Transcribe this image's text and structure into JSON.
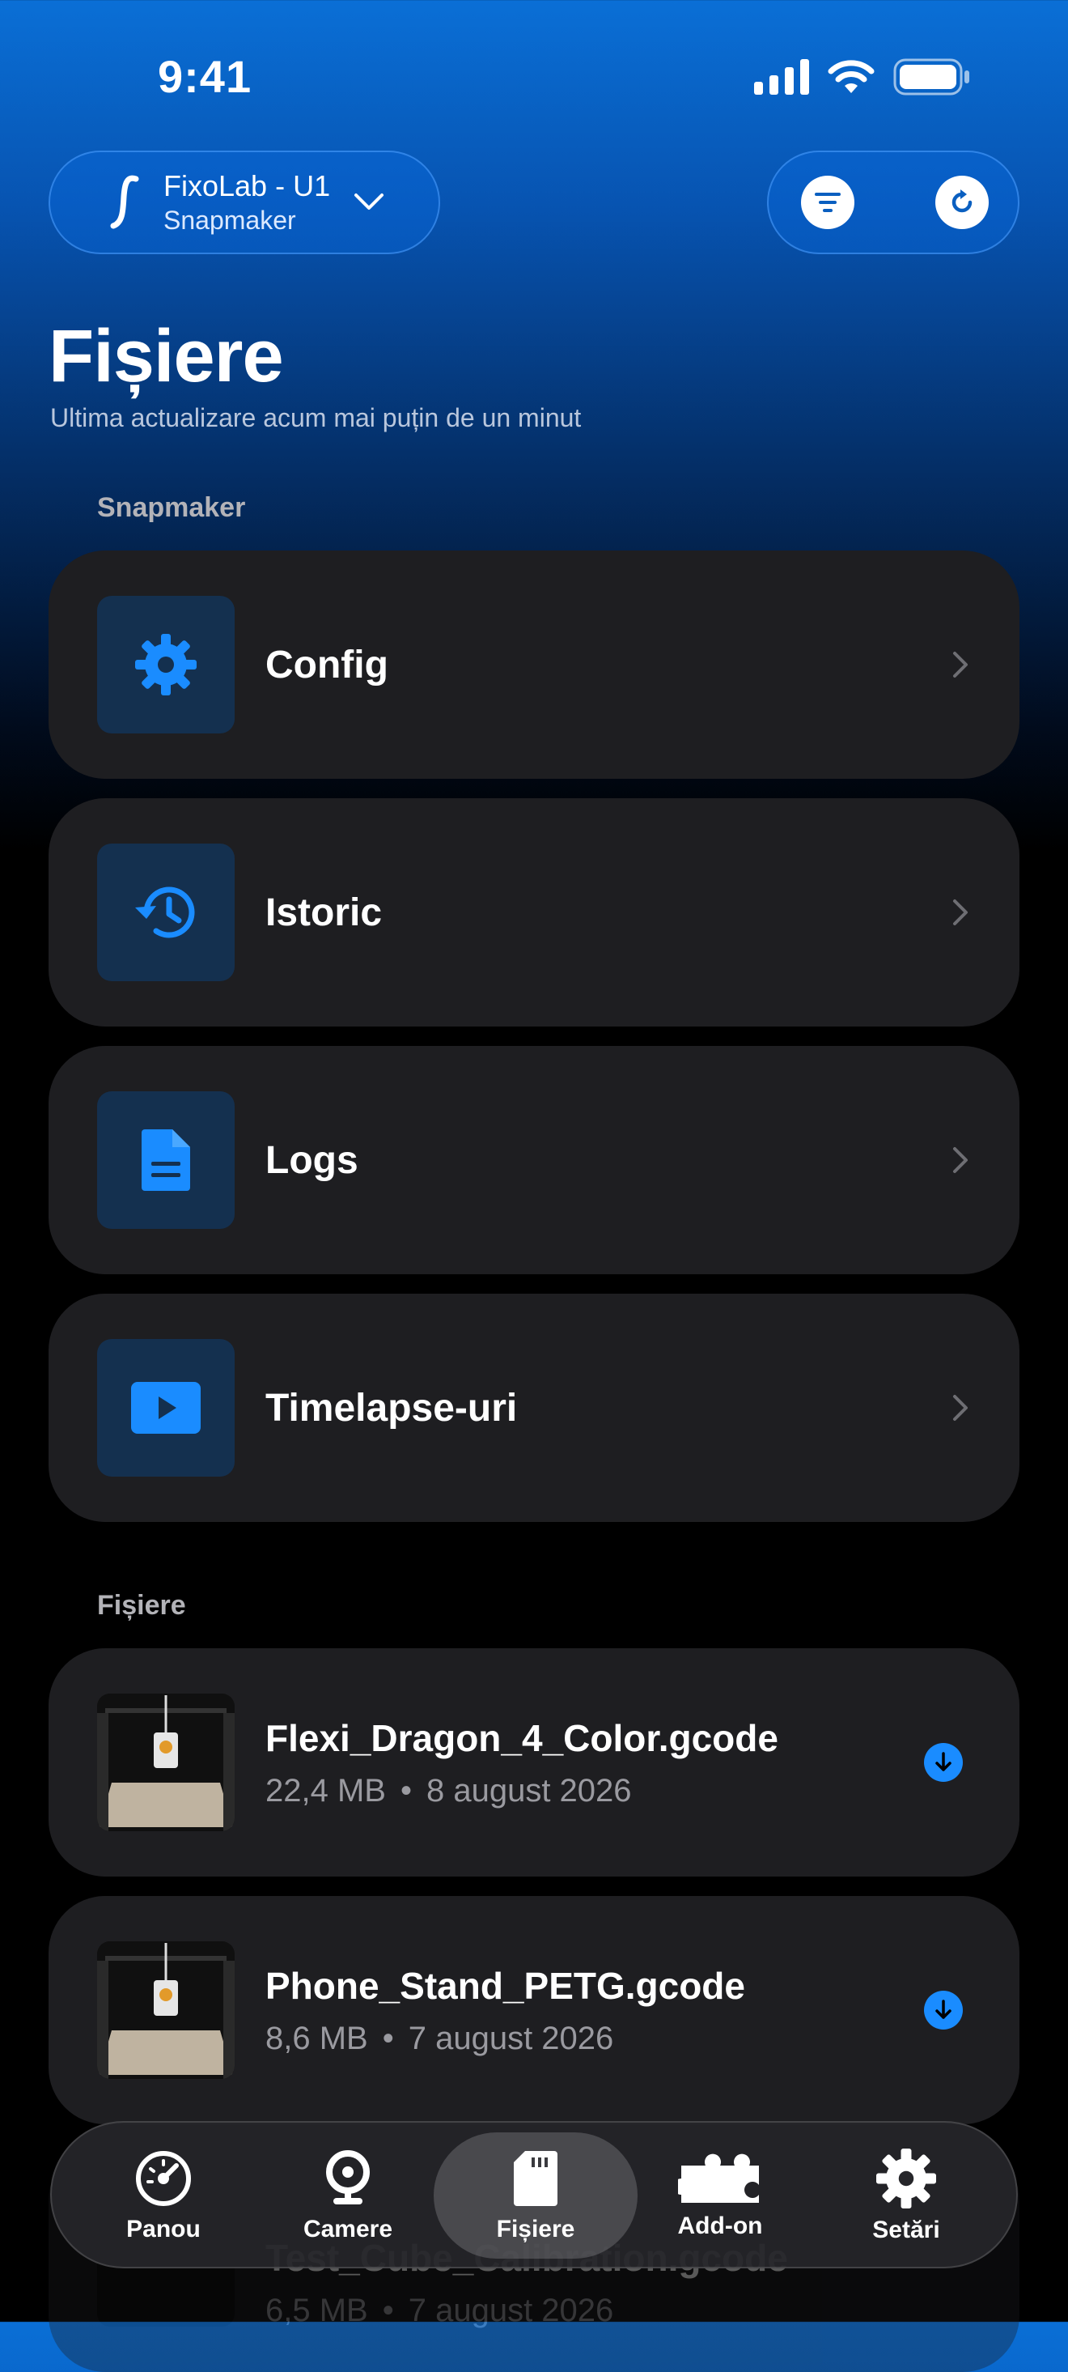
{
  "status_bar": {
    "time": "9:41"
  },
  "printer": {
    "name": "FixoLab - U1",
    "model": "Snapmaker"
  },
  "page": {
    "title": "Fișiere",
    "subtitle": "Ultima actualizare acum mai puțin de un minut"
  },
  "sections": {
    "system": "Snapmaker",
    "files": "Fișiere"
  },
  "system_items": [
    {
      "label": "Config",
      "icon": "gear-icon"
    },
    {
      "label": "Istoric",
      "icon": "history-icon"
    },
    {
      "label": "Logs",
      "icon": "document-icon"
    },
    {
      "label": "Timelapse-uri",
      "icon": "play-icon"
    }
  ],
  "files": [
    {
      "name": "Flexi_Dragon_4_Color.gcode",
      "size": "22,4 MB",
      "date": "8 august 2026"
    },
    {
      "name": "Phone_Stand_PETG.gcode",
      "size": "8,6 MB",
      "date": "7 august 2026"
    },
    {
      "name": "Test_Cube_Calibration.gcode",
      "size": "6,5 MB",
      "date": "7 august 2026"
    }
  ],
  "tabs": [
    {
      "label": "Panou",
      "icon": "gauge-icon"
    },
    {
      "label": "Camere",
      "icon": "webcam-icon"
    },
    {
      "label": "Fișiere",
      "icon": "sd-card-icon"
    },
    {
      "label": "Add-on",
      "icon": "puzzle-icon"
    },
    {
      "label": "Setări",
      "icon": "gear-icon"
    }
  ],
  "active_tab": "Fișiere",
  "colors": {
    "accent": "#1a8cff",
    "card": "#1e1e21",
    "tile": "#14304f"
  }
}
